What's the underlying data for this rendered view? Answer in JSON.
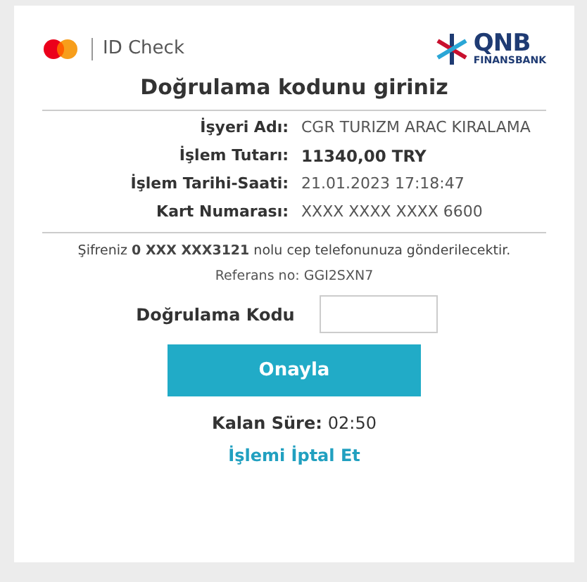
{
  "header": {
    "brand_text": "ID Check",
    "bank_name": "QNB",
    "bank_subname": "FINANSBANK"
  },
  "title": "Doğrulama kodunu giriniz",
  "details": [
    {
      "label": "İşyeri Adı:",
      "value": "CGR TURIZM ARAC KIRALAMA",
      "kind": "normal"
    },
    {
      "label": "İşlem Tutarı:",
      "value": "11340,00 TRY",
      "kind": "emphasis"
    },
    {
      "label": "İşlem Tarihi-Saati:",
      "value": "21.01.2023 17:18:47",
      "kind": "normal"
    },
    {
      "label": "Kart Numarası:",
      "value": "XXXX XXXX XXXX 6600",
      "kind": "normal"
    }
  ],
  "sms_notice": "Şifreniz **0 XXX XXX3121** nolu cep telefonunuza gönderilecektir.",
  "reference": "Referans no: GGI2SXN7",
  "code_field": {
    "label": "Doğrulama Kodu"
  },
  "submit_button": "Onayla",
  "timer": {
    "label": "Kalan Süre:",
    "value": "02:50"
  },
  "cancel_link": "İşlemi İptal Et"
}
